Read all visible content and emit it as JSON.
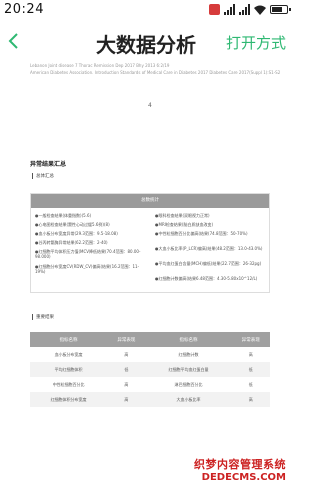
{
  "status_bar": {
    "time": "20:24",
    "app_badge_color": "#d63b3b"
  },
  "header": {
    "title": "大数据分析",
    "open_action": "打开方式"
  },
  "document": {
    "refs": [
      "Lebanon Joint disease 7 Thorac Remission Dep 2017 Bhy 2013 6:2/19",
      "American Diabetes Association. Introduction Standards of Medical Care in Diabetes 2017 Diabetes Care 2017(Suppl 1):S1-S2"
    ],
    "page_number": "4",
    "section_title": "异常结果汇总",
    "summary_label": "总体汇总",
    "summary_header": "总数统计",
    "summary_left": [
      "●一般检查结果(体重指数)(5.6)",
      "●心电图检查结果(窦性心动过缓5.6例)(8)",
      "●血小板分布宽度异常(29.3范围：9.5-18.08)",
      "●谷丙转氨酶异常结果(62.2范围：2-40)",
      "●红细胞平均体积压力值(MCV降低结果(70.4范围：80.00-98.000)",
      "●红细胞分布宽度CV(RDW_CV)偏高(结果(16.2范围：11-19%)"
    ],
    "summary_right": [
      "●眼科检查结果(双眼视力正常)",
      "●MRI检查结果(脑白质缺血改变)",
      "●中性粒细胞百分比偏高(结果(74.8范围：50-70%)",
      "●大血小板比率(P_LCR)偏高(结果(48.2范围：13.0-43.0%)",
      "●平均血红蛋白含量(MCH)偏低(结果(22.7范围：26-32pg)",
      "●红细胞计数偏高(结果6.48范围：4.30-5.80x10^12/L)"
    ],
    "table_label": "重要结果",
    "table": {
      "headers": [
        "指标名称",
        "异常表现",
        "指标名称",
        "异常表现"
      ],
      "rows": [
        [
          "血小板分布宽度",
          "高",
          "红细胞计数",
          "高"
        ],
        [
          "平均红细胞体积",
          "低",
          "红细胞平均血红蛋白量",
          "低"
        ],
        [
          "中性粒细胞百分比",
          "高",
          "淋巴细胞百分比",
          "低"
        ],
        [
          "红细胞体积分布宽度",
          "高",
          "大血小板比率",
          "高"
        ]
      ]
    }
  },
  "watermark": {
    "cn": "织梦内容管理系统",
    "en": "DEDECMS.COM"
  }
}
